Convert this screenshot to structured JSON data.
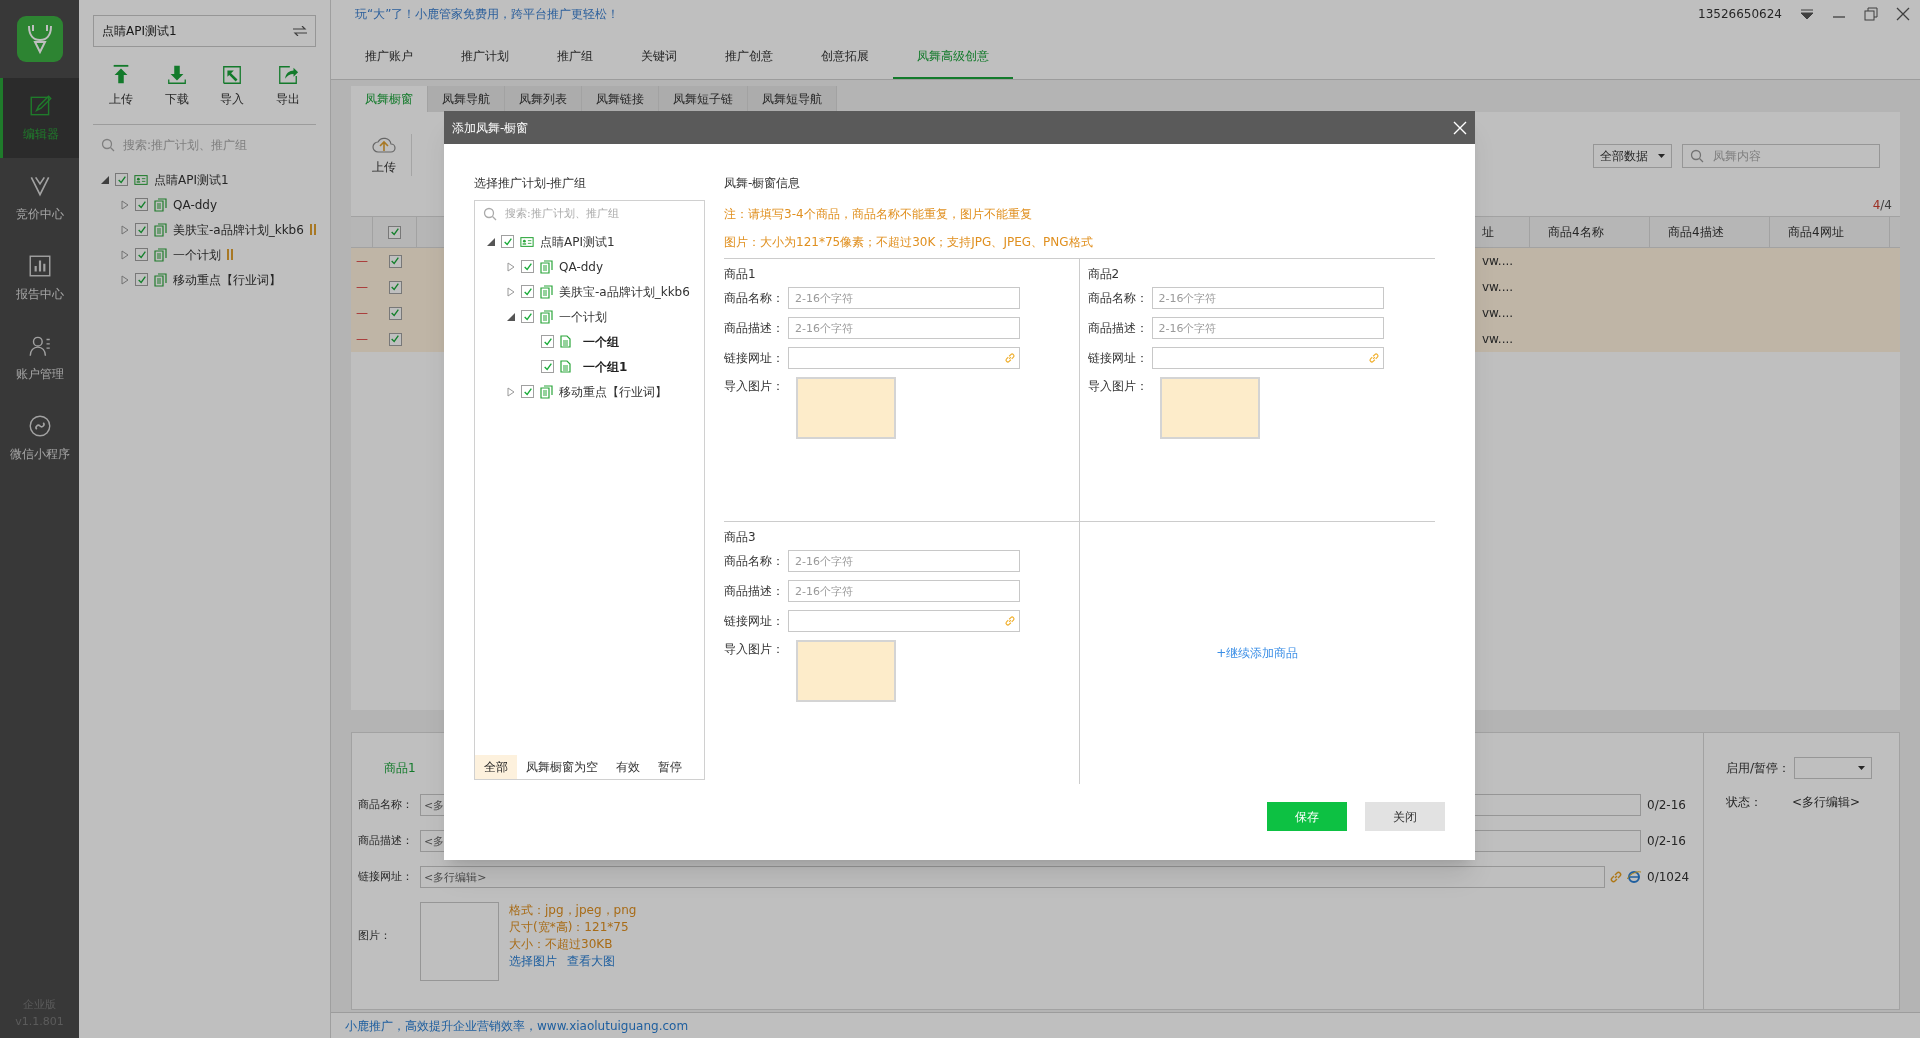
{
  "sidebar": {
    "items": [
      {
        "label": "编辑器",
        "kind": "editor",
        "selected": true
      },
      {
        "label": "竞价中心",
        "kind": "bidding",
        "selected": false
      },
      {
        "label": "报告中心",
        "kind": "report",
        "selected": false
      },
      {
        "label": "账户管理",
        "kind": "account",
        "selected": false
      },
      {
        "label": "微信小程序",
        "kind": "miniapp",
        "selected": false
      }
    ],
    "edition": "企业版",
    "version": "v1.1.801"
  },
  "account_panel": {
    "account": "点睛API测试1",
    "tools": [
      {
        "label": "上传",
        "kind": "upload"
      },
      {
        "label": "下载",
        "kind": "download"
      },
      {
        "label": "导入",
        "kind": "import"
      },
      {
        "label": "导出",
        "kind": "export"
      }
    ],
    "search_placeholder": "搜索:推广计划、推广组",
    "tree": [
      {
        "label": "点睛API测试1",
        "kind": "account",
        "checked": true,
        "expanded": true,
        "paused": false,
        "children": [
          {
            "label": "QA-ddy",
            "kind": "plan",
            "checked": true,
            "expanded": false,
            "paused": false
          },
          {
            "label": "美肤宝-a品牌计划_kkb6",
            "kind": "plan",
            "checked": true,
            "expanded": false,
            "paused": true
          },
          {
            "label": "一个计划",
            "kind": "plan",
            "checked": true,
            "expanded": false,
            "paused": true
          },
          {
            "label": "移动重点【行业词】",
            "kind": "plan",
            "checked": true,
            "expanded": false,
            "paused": false
          }
        ]
      }
    ]
  },
  "header": {
    "promo": "玩“大”了！小鹿管家免费用，跨平台推广更轻松！",
    "phone": "13526650624"
  },
  "nav_tabs": [
    {
      "label": "推广账户",
      "selected": false
    },
    {
      "label": "推广计划",
      "selected": false
    },
    {
      "label": "推广组",
      "selected": false
    },
    {
      "label": "关键词",
      "selected": false
    },
    {
      "label": "推广创意",
      "selected": false
    },
    {
      "label": "创意拓展",
      "selected": false
    },
    {
      "label": "凤舞高级创意",
      "selected": true
    }
  ],
  "sub_tabs": [
    {
      "label": "凤舞橱窗",
      "selected": true
    },
    {
      "label": "凤舞导航",
      "selected": false
    },
    {
      "label": "凤舞列表",
      "selected": false
    },
    {
      "label": "凤舞链接",
      "selected": false
    },
    {
      "label": "凤舞短子链",
      "selected": false
    },
    {
      "label": "凤舞短导航",
      "selected": false
    }
  ],
  "toolbar": {
    "upload": "上传",
    "filter": "全部数据",
    "search_placeholder": "凤舞内容",
    "count": {
      "current": "4",
      "rest": "/4"
    }
  },
  "table": {
    "header_checked": true,
    "columns": [
      "址",
      "商品4名称",
      "商品4描述",
      "商品4网址"
    ],
    "rows": [
      {
        "marker": "—",
        "checked": true,
        "column_1": "vw...."
      },
      {
        "marker": "—",
        "checked": true,
        "column_1": "vw...."
      },
      {
        "marker": "—",
        "checked": true,
        "column_1": "vw...."
      },
      {
        "marker": "—",
        "checked": true,
        "column_1": "vw...."
      }
    ]
  },
  "editor": {
    "tabs": [
      {
        "label": "商品1",
        "selected": true
      }
    ],
    "fields": [
      {
        "label": "商品名称：",
        "value": "<多",
        "counter": "0/2-16",
        "kind": "text"
      },
      {
        "label": "商品描述：",
        "value": "<多",
        "counter": "0/2-16",
        "kind": "text"
      },
      {
        "label": "链接网址：",
        "value": "<多行编辑>",
        "counter": "0/1024",
        "kind": "url"
      }
    ],
    "image": {
      "label": "图片：",
      "hints": [
        "格式：jpg，jpeg，png",
        "尺寸(宽*高)：121*75",
        "大小：不超过30KB"
      ],
      "links": [
        "选择图片",
        "查看大图"
      ]
    },
    "status_panel": {
      "toggle_label": "启用/暂停：",
      "status_label": "状态：",
      "status_value": "<多行编辑>"
    }
  },
  "footer": "小鹿推广，高效提升企业营销效率，www.xiaolutuiguang.com",
  "dialog": {
    "title": "添加凤舞-橱窗",
    "left_title": "选择推广计划-推广组",
    "search_placeholder": "搜索:推广计划、推广组",
    "tree": [
      {
        "label": "点睛API测试1",
        "kind": "account",
        "checked": true,
        "expanded": true,
        "children": [
          {
            "label": "QA-ddy",
            "kind": "plan",
            "checked": true,
            "expanded": false
          },
          {
            "label": "美肤宝-a品牌计划_kkb6",
            "kind": "plan",
            "checked": true,
            "expanded": false
          },
          {
            "label": "一个计划",
            "kind": "plan",
            "checked": true,
            "expanded": true,
            "children": [
              {
                "label": "一个组",
                "kind": "group",
                "checked": true
              },
              {
                "label": "一个组1",
                "kind": "group",
                "checked": true
              }
            ]
          },
          {
            "label": "移动重点【行业词】",
            "kind": "plan",
            "checked": true,
            "expanded": false
          }
        ]
      }
    ],
    "filters": [
      {
        "label": "全部",
        "selected": true
      },
      {
        "label": "凤舞橱窗为空",
        "selected": false
      },
      {
        "label": "有效",
        "selected": false
      },
      {
        "label": "暂停",
        "selected": false
      }
    ],
    "right_title": "凤舞-橱窗信息",
    "notes": [
      "注：请填写3-4个商品，商品名称不能重复，图片不能重复",
      "图片：大小为121*75像素；不超过30K；支持JPG、JPEG、PNG格式"
    ],
    "products": [
      {
        "title": "商品1",
        "fields": [
          {
            "label": "商品名称：",
            "placeholder": "2-16个字符",
            "kind": "text"
          },
          {
            "label": "商品描述：",
            "placeholder": "2-16个字符",
            "kind": "text"
          },
          {
            "label": "链接网址：",
            "kind": "url"
          }
        ],
        "image_label": "导入图片："
      },
      {
        "title": "商品2",
        "fields": [
          {
            "label": "商品名称：",
            "placeholder": "2-16个字符",
            "kind": "text"
          },
          {
            "label": "商品描述：",
            "placeholder": "2-16个字符",
            "kind": "text"
          },
          {
            "label": "链接网址：",
            "kind": "url"
          }
        ],
        "image_label": "导入图片："
      },
      {
        "title": "商品3",
        "fields": [
          {
            "label": "商品名称：",
            "placeholder": "2-16个字符",
            "kind": "text"
          },
          {
            "label": "商品描述：",
            "placeholder": "2-16个字符",
            "kind": "text"
          },
          {
            "label": "链接网址：",
            "kind": "url"
          }
        ],
        "image_label": "导入图片："
      }
    ],
    "add_more": "+继续添加商品",
    "buttons": [
      {
        "label": "保存",
        "kind": "primary"
      },
      {
        "label": "关闭",
        "kind": "secondary"
      }
    ]
  }
}
